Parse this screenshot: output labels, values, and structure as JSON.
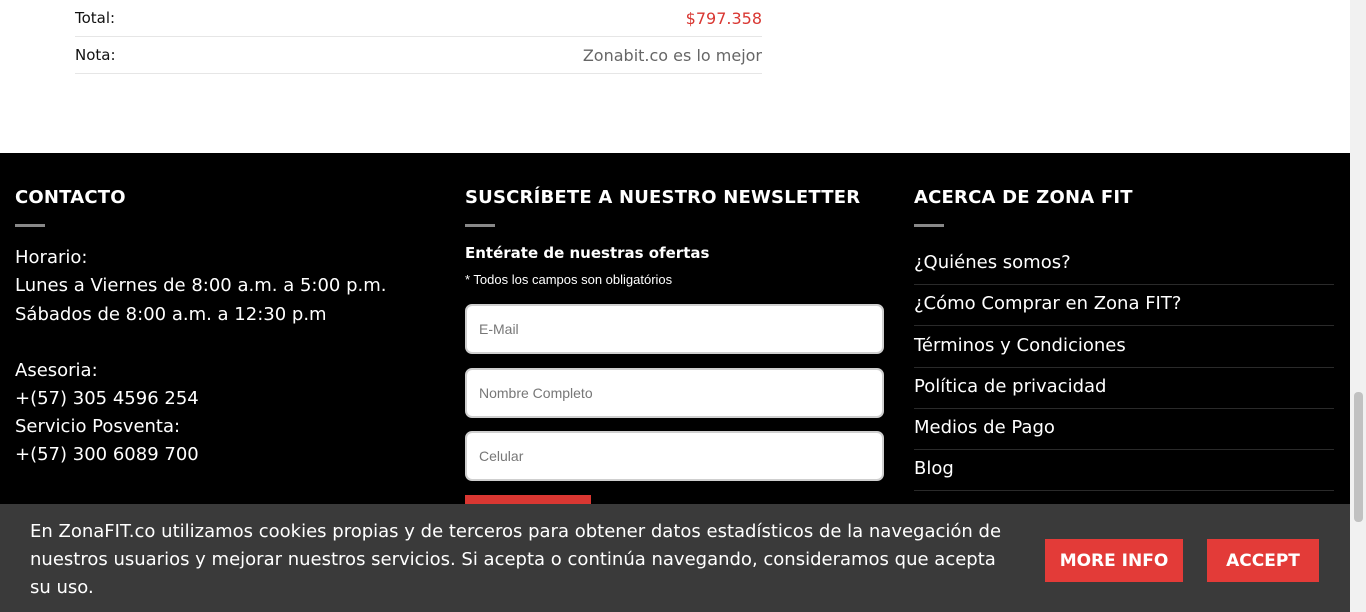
{
  "order_summary": {
    "total_label": "Total:",
    "total_value": "$797.358",
    "note_label": "Nota:",
    "note_value": "Zonabit.co es lo mejor"
  },
  "footer": {
    "contact": {
      "title": "CONTACTO",
      "lines": [
        "Horario:",
        "Lunes a Viernes de 8:00 a.m. a 5:00 p.m.",
        "Sábados de 8:00 a.m. a 12:30 p.m",
        "Asesoria:",
        "+(57) 305 4596 254",
        "Servicio Posventa:",
        "+(57) 300 6089 700"
      ]
    },
    "newsletter": {
      "title": "SUSCRÍBETE A NUESTRO NEWSLETTER",
      "subtitle": "Entérate de nuestras ofertas",
      "required_note": "* Todos los campos son obligatórios",
      "email_placeholder": "E-Mail",
      "name_placeholder": "Nombre Completo",
      "phone_placeholder": "Celular"
    },
    "about": {
      "title": "ACERCA DE ZONA FIT",
      "links": [
        "¿Quiénes somos?",
        "¿Cómo Comprar en Zona FIT?",
        "Términos y Condiciones",
        "Política de privacidad",
        "Medios de Pago",
        "Blog"
      ]
    }
  },
  "cookie_banner": {
    "text": "En ZonaFIT.co utilizamos cookies propias y de terceros para obtener datos estadísticos de la navegación de nuestros usuarios y mejorar nuestros servicios. Si acepta o continúa navegando, consideramos que acepta su uso.",
    "more_info_label": "MORE INFO",
    "accept_label": "ACCEPT"
  },
  "colors": {
    "accent_red": "#d93732",
    "footer_bg": "#000000",
    "banner_bg": "#3a3a3a"
  }
}
